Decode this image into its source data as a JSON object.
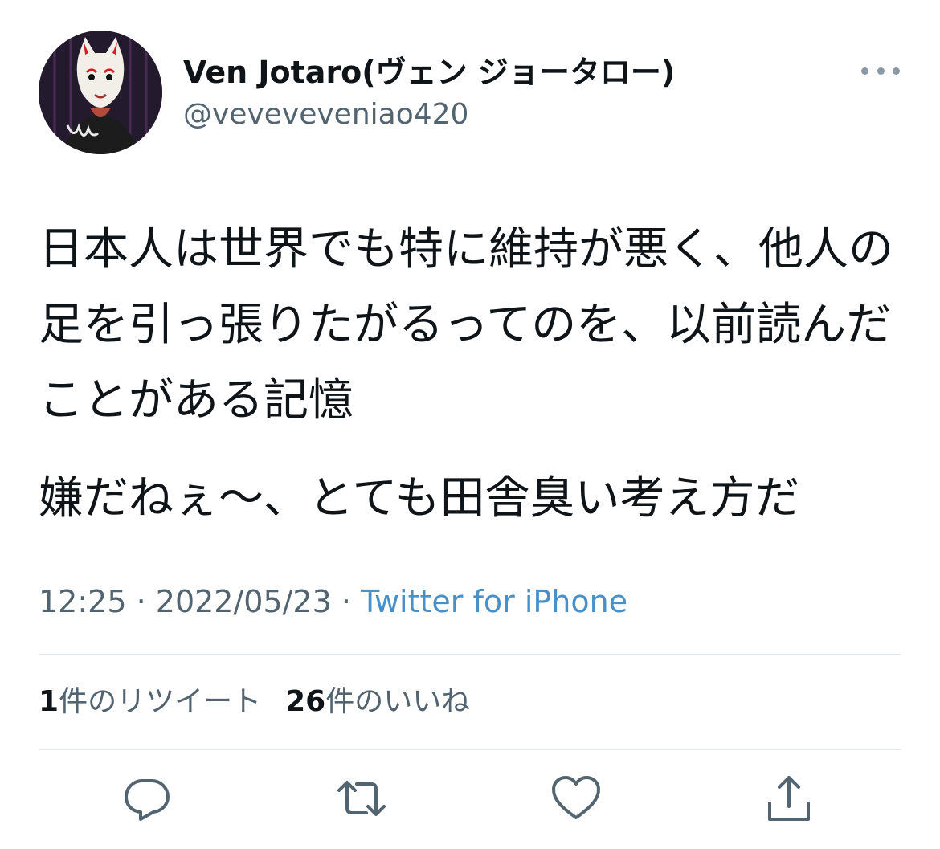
{
  "author": {
    "display_name": "Ven Jotaro(ヴェン ジョータロー)",
    "handle": "@veveveveniao420"
  },
  "tweet": {
    "paragraphs": [
      "日本人は世界でも特に維持が悪く、他人の足を引っ張りたがるってのを、以前読んだことがある記憶",
      "嫌だねぇ〜、とても田舎臭い考え方だ"
    ],
    "time": "12:25",
    "date": "2022/05/23",
    "separator": " · ",
    "source": "Twitter for iPhone"
  },
  "stats": {
    "retweets_count": "1",
    "retweets_label": "件のリツイート",
    "likes_count": "26",
    "likes_label": "件のいいね"
  },
  "colors": {
    "text_primary": "#0f1419",
    "text_secondary": "#536471",
    "link": "#4a90c8",
    "icon": "#536471",
    "divider": "#e6e9ec"
  },
  "icons": {
    "more": "more-horizontal-icon",
    "reply": "reply-icon",
    "retweet": "retweet-icon",
    "like": "heart-icon",
    "share": "share-icon"
  }
}
